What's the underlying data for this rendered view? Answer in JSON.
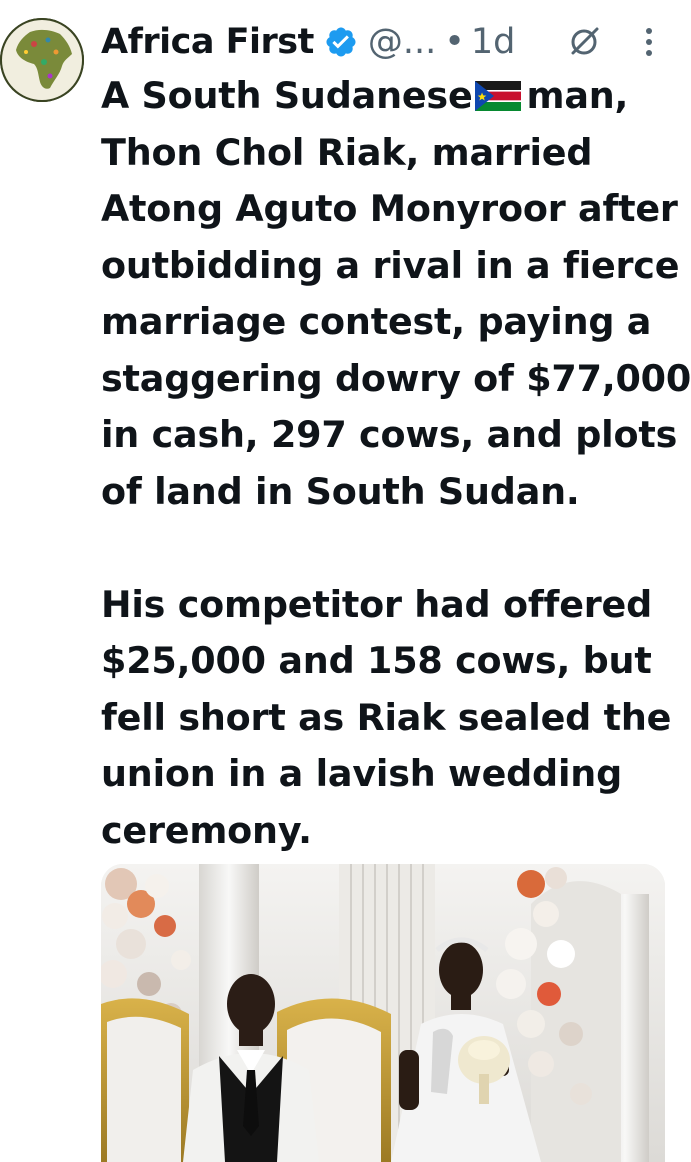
{
  "author": {
    "name": "Africa First",
    "handle": "@...",
    "separator": "•",
    "time": "1d",
    "verified": true,
    "verified_color": "#1d9bf0"
  },
  "icons": {
    "avatar": "africa-map-avatar",
    "verified": "verified-badge-icon",
    "grok": "grok-icon",
    "more": "more-vertical-icon",
    "flag": "south-sudan-flag-icon"
  },
  "post": {
    "paragraph1": [
      {
        "before": "A South Sudanese",
        "after": "man,"
      },
      "Thon Chol Riak, married",
      "Atong Aguto Monyroor after",
      "outbidding a rival in a fierce",
      "marriage contest, paying a",
      "staggering dowry of $77,000",
      "in cash, 297 cows, and plots",
      "of land in South Sudan."
    ],
    "paragraph2": [
      "His competitor had offered",
      "$25,000 and 158 cows, but",
      "fell short as Riak sealed the",
      "union in a lavish wedding",
      "ceremony."
    ]
  },
  "media": {
    "type": "photo",
    "scene": "wedding-couple-photo"
  }
}
